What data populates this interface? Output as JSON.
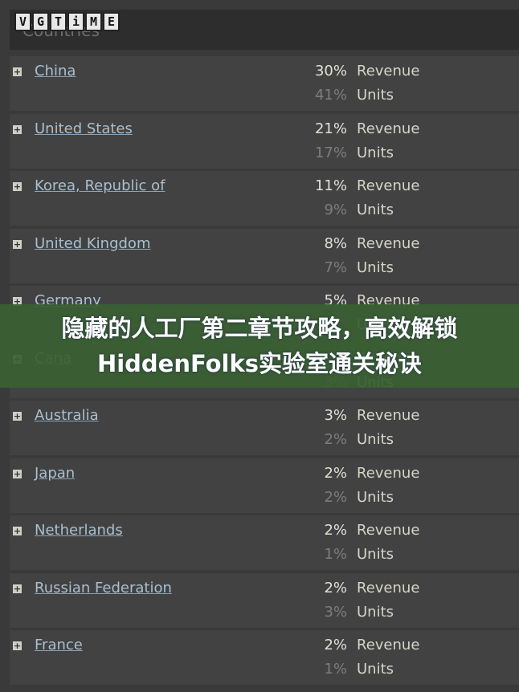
{
  "watermark": "VGTIME",
  "header": {
    "title": "Countries"
  },
  "revenue_label": "Revenue",
  "units_label": "Units",
  "countries": [
    {
      "name": "China",
      "revenue": "30%",
      "units": "41%"
    },
    {
      "name": "United States",
      "revenue": "21%",
      "units": "17%"
    },
    {
      "name": "Korea, Republic of",
      "revenue": "11%",
      "units": "9%"
    },
    {
      "name": "United Kingdom",
      "revenue": "8%",
      "units": "7%"
    },
    {
      "name": "Germany",
      "revenue": "5%",
      "units": null
    },
    {
      "name": "Cana",
      "revenue": null,
      "units": "3%"
    },
    {
      "name": "Australia",
      "revenue": "3%",
      "units": "2%"
    },
    {
      "name": "Japan",
      "revenue": "2%",
      "units": "2%"
    },
    {
      "name": "Netherlands",
      "revenue": "2%",
      "units": "1%"
    },
    {
      "name": "Russian Federation",
      "revenue": "2%",
      "units": "3%"
    },
    {
      "name": "France",
      "revenue": "2%",
      "units": "1%"
    }
  ],
  "overlay": {
    "title": "隐藏的人工厂第二章节攻略，高效解锁HiddenFolks实验室通关秘诀"
  }
}
